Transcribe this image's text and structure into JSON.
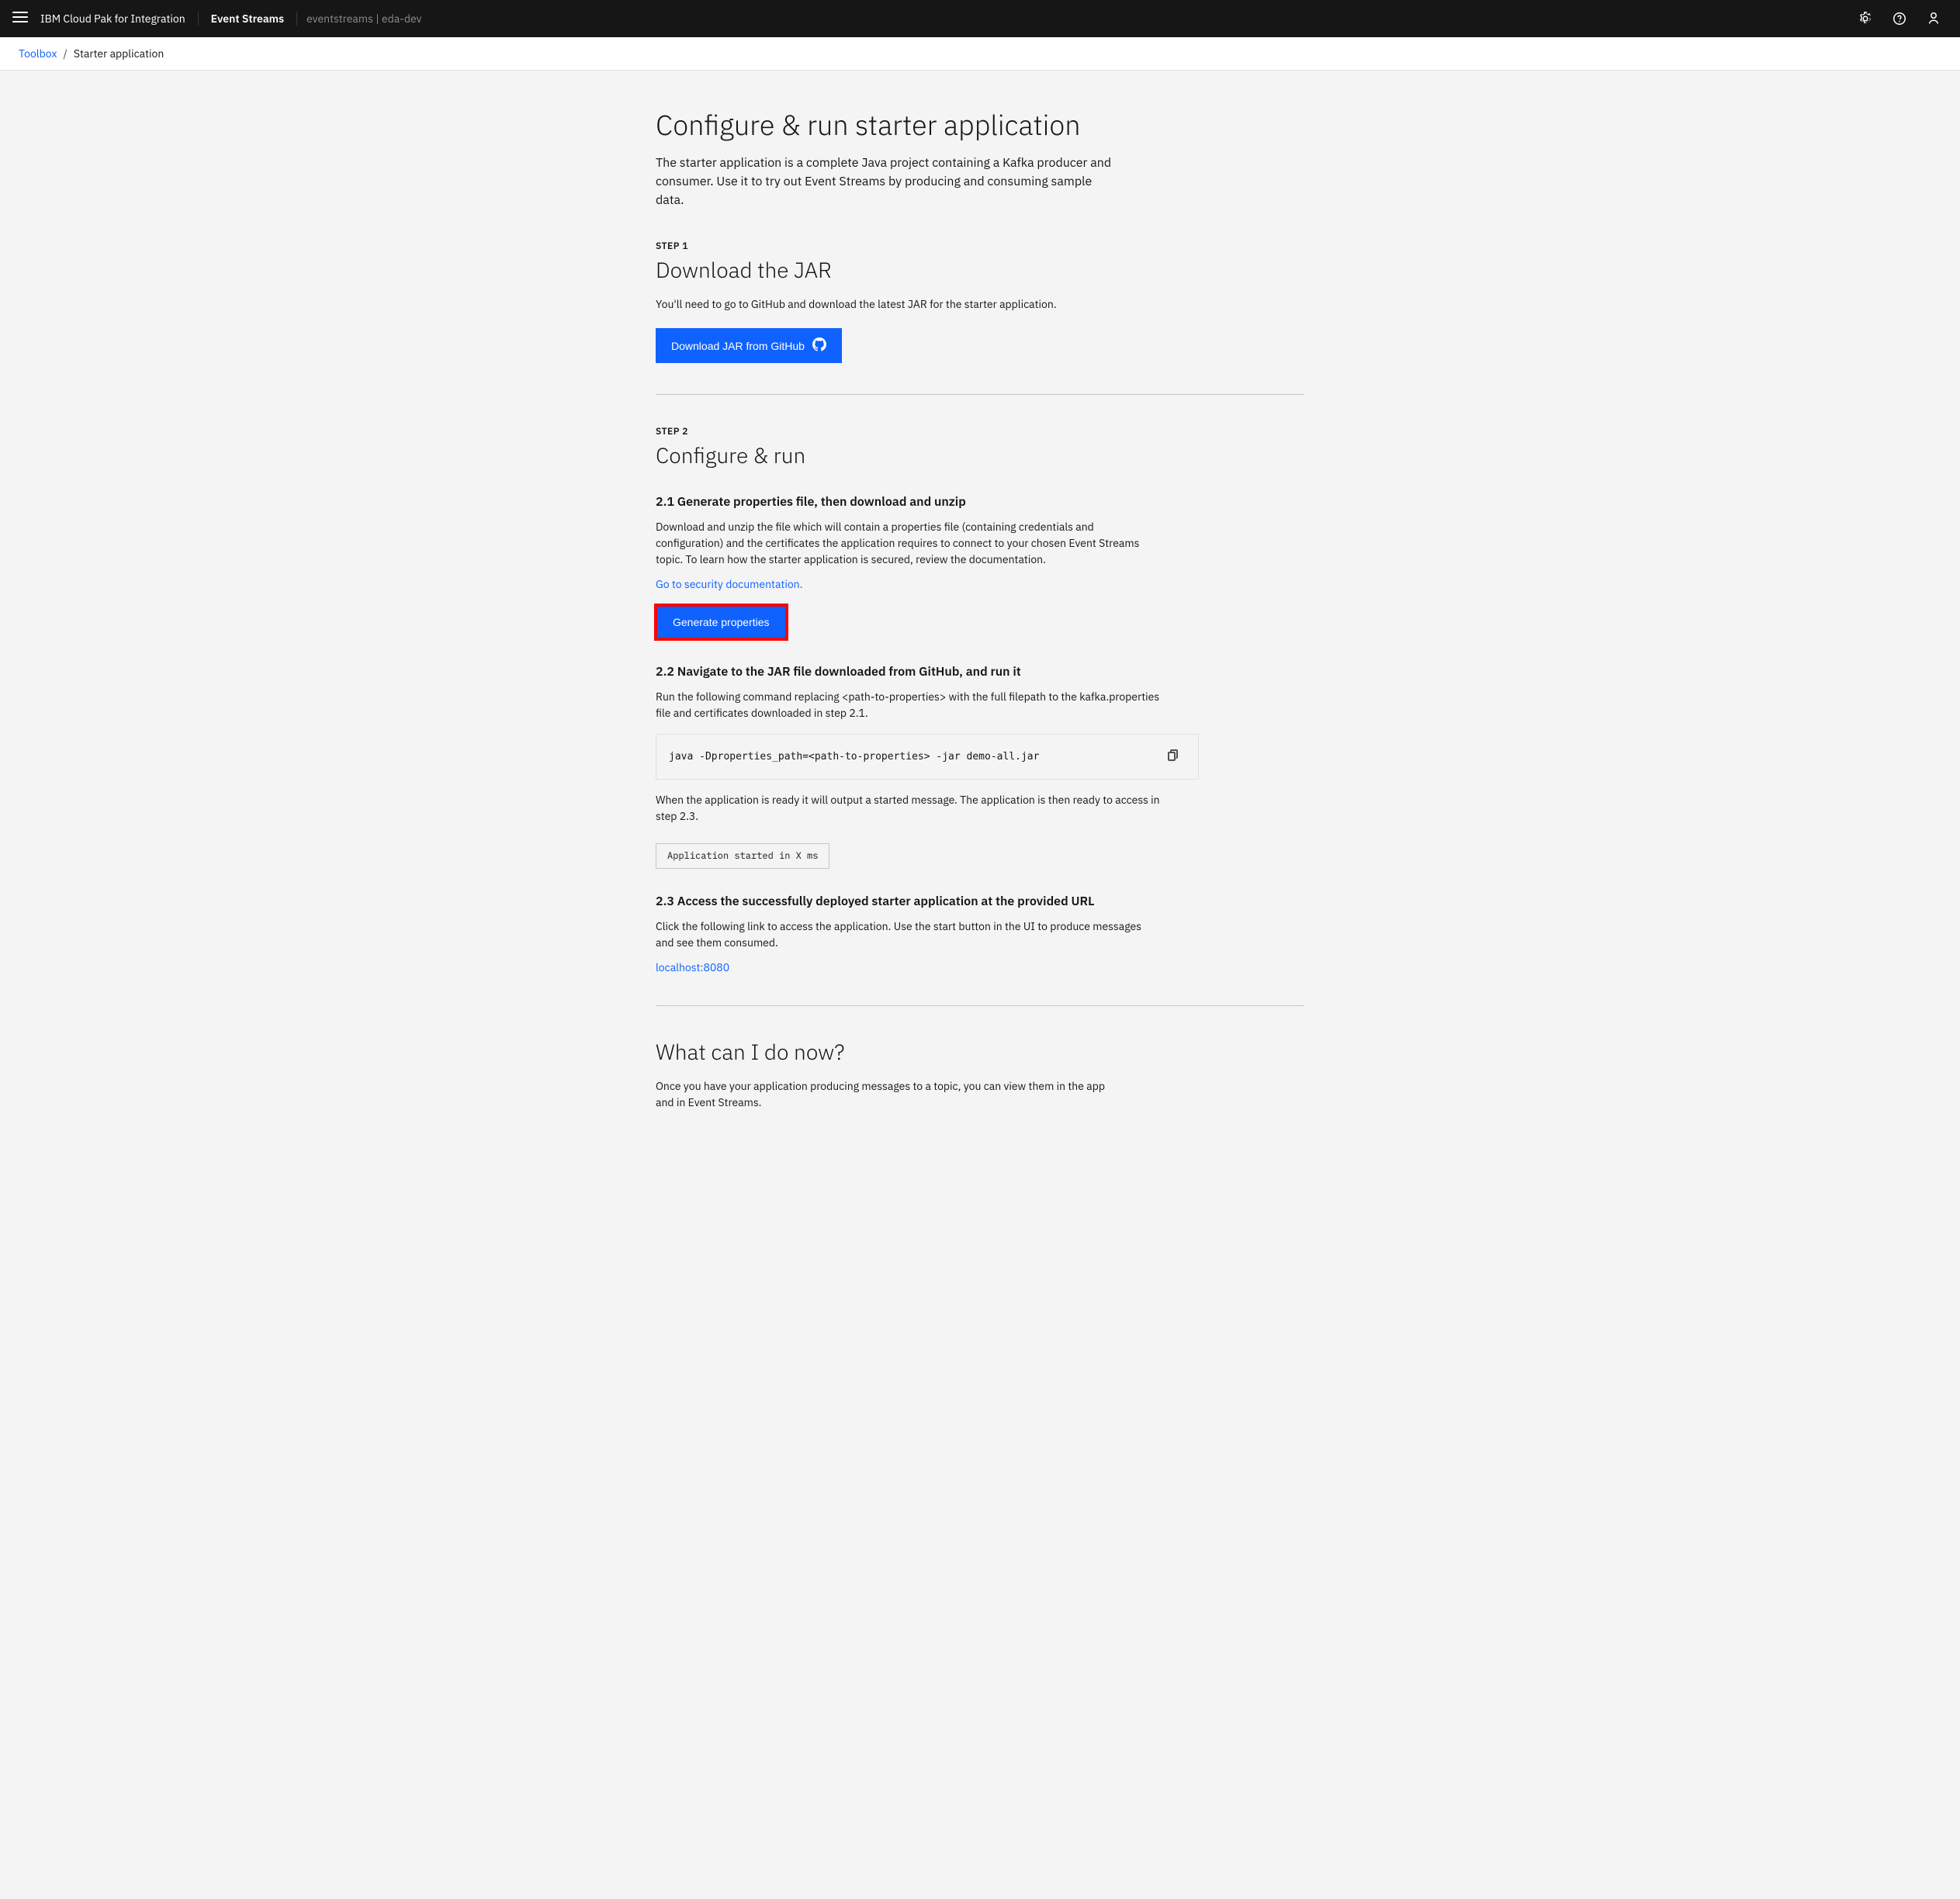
{
  "topbar": {
    "menu_label": "☰",
    "brand": "IBM Cloud Pak for Integration",
    "product": "Event Streams",
    "instance": "eventstreams | eda-dev",
    "settings_icon": "⚙",
    "help_icon": "?",
    "user_icon": "👤"
  },
  "breadcrumb": {
    "toolbox_label": "Toolbox",
    "separator": "/",
    "current": "Starter application"
  },
  "page": {
    "title": "Configure & run starter application",
    "description": "The starter application is a complete Java project containing a Kafka producer and consumer. Use it to try out Event Streams by producing and consuming sample data.",
    "step1": {
      "label": "Step 1",
      "title": "Download the JAR",
      "description": "You'll need to go to GitHub and download the latest JAR for the starter application.",
      "download_btn": "Download JAR from GitHub"
    },
    "step2": {
      "label": "Step 2",
      "title": "Configure & run",
      "substep21": {
        "title": "2.1 Generate properties file, then download and unzip",
        "description": "Download and unzip the file which will contain a properties file (containing credentials and configuration) and the certificates the application requires to connect to your chosen Event Streams topic. To learn how the starter application is secured, review the documentation.",
        "link": "Go to security documentation.",
        "btn": "Generate properties"
      },
      "substep22": {
        "title": "2.2 Navigate to the JAR file downloaded from GitHub, and run it",
        "description": "Run the following command replacing <path-to-properties> with the full filepath to the kafka.properties file and certificates downloaded in step 2.1.",
        "code": "java -Dproperties_path=<path-to-properties> -jar demo-all.jar",
        "after_text": "When the application is ready it will output a started message. The application is then ready to access in step 2.3.",
        "badge": "Application started in X ms"
      },
      "substep23": {
        "title": "2.3 Access the successfully deployed starter application at the provided URL",
        "description": "Click the following link to access the application. Use the start button in the UI to produce messages and see them consumed.",
        "link": "localhost:8080"
      }
    },
    "what_now": {
      "title": "What can I do now?",
      "description": "Once you have your application producing messages to a topic, you can view them in the app and in Event Streams."
    }
  }
}
